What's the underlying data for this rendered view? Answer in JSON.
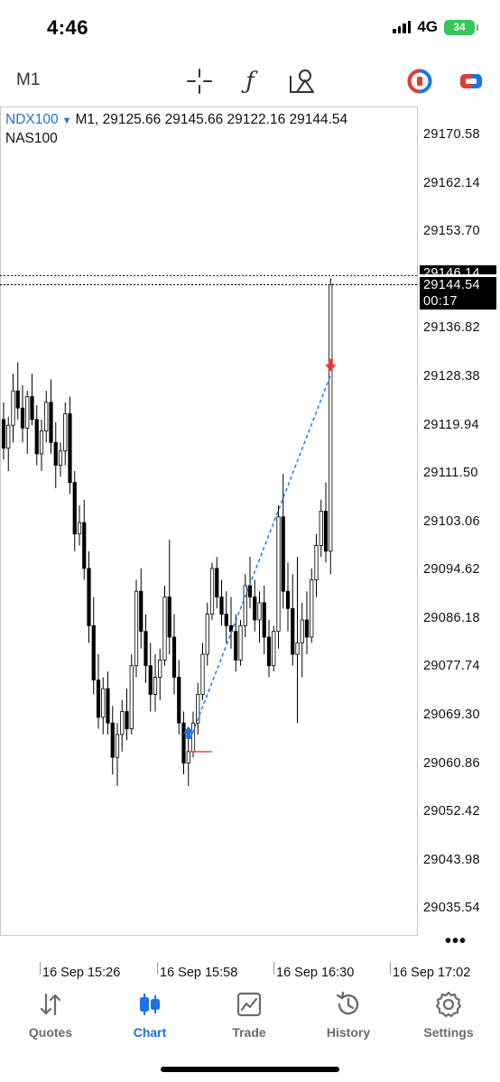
{
  "status": {
    "time": "4:46",
    "network": "4G",
    "battery": "34"
  },
  "toolbar": {
    "timeframe": "M1",
    "icons": [
      "crosshair-icon",
      "indicators-f-icon",
      "objects-icon",
      "one-click-trading-icon",
      "trade-panel-icon"
    ],
    "f_glyph": "ƒ",
    "accent": "#1a73e8",
    "red": "#e53935"
  },
  "chart": {
    "symbol": "NDX100",
    "ohlc_line": "M1, 29125.66 29145.66 29122.16 29144.54",
    "description": "NAS100",
    "price_labels": [
      "29170.58",
      "29162.14",
      "29153.70",
      "29136.82",
      "29128.38",
      "29119.94",
      "29111.50",
      "29103.06",
      "29094.62",
      "29086.18",
      "29077.74",
      "29069.30",
      "29060.86",
      "29052.42",
      "29043.98",
      "29035.54"
    ],
    "ask_label": "29146.14",
    "bid_label": "29144.54",
    "countdown": "00:17",
    "time_labels": [
      "16 Sep 15:26",
      "16 Sep 15:58",
      "16 Sep 16:30",
      "16 Sep 17:02"
    ],
    "more": "•••"
  },
  "chart_data": {
    "type": "candlestick",
    "symbol": "NDX100",
    "timeframe": "M1",
    "y_range": [
      29031.0,
      29175.5
    ],
    "candles": [
      [
        29121.0,
        29124.0,
        29114.0,
        29116.0
      ],
      [
        29116.0,
        29121.5,
        29112.0,
        29120.0
      ],
      [
        29120.0,
        29129.0,
        29117.0,
        29126.0
      ],
      [
        29126.0,
        29131.0,
        29121.0,
        29123.0
      ],
      [
        29123.0,
        29127.0,
        29117.0,
        29119.5
      ],
      [
        29119.5,
        29126.0,
        29115.0,
        29125.0
      ],
      [
        29125.0,
        29129.0,
        29120.0,
        29121.0
      ],
      [
        29121.0,
        29123.5,
        29113.0,
        29115.0
      ],
      [
        29115.0,
        29121.0,
        29112.0,
        29119.0
      ],
      [
        29119.0,
        29126.0,
        29117.0,
        29124.0
      ],
      [
        29124.0,
        29128.0,
        29115.0,
        29117.0
      ],
      [
        29117.0,
        29120.5,
        29109.0,
        29113.0
      ],
      [
        29113.0,
        29117.0,
        29111.0,
        29115.5
      ],
      [
        29115.5,
        29124.0,
        29113.0,
        29122.0
      ],
      [
        29122.0,
        29125.0,
        29108.0,
        29110.0
      ],
      [
        29110.0,
        29112.0,
        29098.0,
        29101.0
      ],
      [
        29101.0,
        29106.0,
        29099.0,
        29103.0
      ],
      [
        29103.0,
        29107.0,
        29093.0,
        29095.0
      ],
      [
        29095.0,
        29098.0,
        29082.0,
        29085.0
      ],
      [
        29085.0,
        29090.0,
        29073.0,
        29075.5
      ],
      [
        29075.5,
        29080.0,
        29067.0,
        29069.0
      ],
      [
        29069.0,
        29076.0,
        29066.0,
        29074.0
      ],
      [
        29074.0,
        29077.0,
        29066.0,
        29068.0
      ],
      [
        29068.0,
        29071.0,
        29059.0,
        29062.0
      ],
      [
        29062.0,
        29068.0,
        29057.0,
        29066.0
      ],
      [
        29066.0,
        29072.0,
        29063.0,
        29070.0
      ],
      [
        29070.0,
        29074.0,
        29065.0,
        29067.0
      ],
      [
        29067.0,
        29080.0,
        29066.0,
        29078.0
      ],
      [
        29078.0,
        29093.0,
        29076.0,
        29091.0
      ],
      [
        29091.0,
        29095.0,
        29081.0,
        29084.0
      ],
      [
        29084.0,
        29087.0,
        29075.0,
        29078.0
      ],
      [
        29078.0,
        29082.0,
        29070.0,
        29073.0
      ],
      [
        29073.0,
        29080.0,
        29070.0,
        29076.0
      ],
      [
        29076.0,
        29081.0,
        29072.0,
        29079.0
      ],
      [
        29079.0,
        29092.0,
        29078.0,
        29090.0
      ],
      [
        29090.0,
        29100.0,
        29080.0,
        29083.0
      ],
      [
        29083.0,
        29087.0,
        29073.0,
        29076.0
      ],
      [
        29076.0,
        29079.0,
        29066.0,
        29068.0
      ],
      [
        29068.0,
        29070.0,
        29059.0,
        29061.0
      ],
      [
        29061.0,
        29065.5,
        29057.0,
        29063.0
      ],
      [
        29063.0,
        29070.0,
        29062.0,
        29068.0
      ],
      [
        29068.0,
        29075.0,
        29066.0,
        29073.0
      ],
      [
        29073.0,
        29082.0,
        29072.0,
        29080.0
      ],
      [
        29080.0,
        29089.0,
        29078.0,
        29087.0
      ],
      [
        29087.0,
        29096.0,
        29086.0,
        29095.0
      ],
      [
        29095.0,
        29097.0,
        29088.0,
        29090.0
      ],
      [
        29090.0,
        29093.0,
        29085.0,
        29087.0
      ],
      [
        29087.0,
        29091.0,
        29082.0,
        29085.0
      ],
      [
        29085.0,
        29090.0,
        29081.0,
        29084.0
      ],
      [
        29084.0,
        29087.0,
        29077.0,
        29079.0
      ],
      [
        29079.0,
        29086.0,
        29078.0,
        29085.0
      ],
      [
        29085.0,
        29094.0,
        29083.0,
        29092.0
      ],
      [
        29092.0,
        29097.0,
        29088.0,
        29090.0
      ],
      [
        29090.0,
        29093.0,
        29084.0,
        29086.0
      ],
      [
        29086.0,
        29091.0,
        29082.0,
        29089.0
      ],
      [
        29089.0,
        29092.0,
        29080.0,
        29083.0
      ],
      [
        29083.0,
        29086.0,
        29076.0,
        29078.0
      ],
      [
        29078.0,
        29085.0,
        29077.0,
        29084.0
      ],
      [
        29084.0,
        29106.0,
        29081.0,
        29104.0
      ],
      [
        29104.0,
        29111.5,
        29088.0,
        29091.0
      ],
      [
        29091.0,
        29096.0,
        29084.0,
        29088.0
      ],
      [
        29088.0,
        29094.0,
        29078.0,
        29080.0
      ],
      [
        29080.0,
        29097.0,
        29068.0,
        29082.0
      ],
      [
        29082.0,
        29089.0,
        29076.0,
        29086.0
      ],
      [
        29086.0,
        29091.0,
        29080.0,
        29083.0
      ],
      [
        29083.0,
        29095.0,
        29082.0,
        29093.0
      ],
      [
        29093.0,
        29101.0,
        29090.0,
        29099.0
      ],
      [
        29099.0,
        29107.0,
        29097.0,
        29105.0
      ],
      [
        29105.0,
        29110.0,
        29096.0,
        29098.0
      ],
      [
        29098.0,
        29145.66,
        29094.0,
        29144.54
      ]
    ],
    "ask": 29146.14,
    "bid": 29144.54,
    "last_ohlc": {
      "open": 29125.66,
      "high": 29145.66,
      "low": 29122.16,
      "close": 29144.54
    },
    "trade": {
      "entry_time_index": 39,
      "entry_price": 29063.0,
      "exit_time_index": 69,
      "exit_price": 29130.0
    },
    "colors": {
      "bull": "#ffffff",
      "bear": "#000000",
      "trade_line": "#1a73e8",
      "buy_arrow": "#1a73e8",
      "sell_arrow": "#e53935"
    }
  },
  "tabs": [
    {
      "label": "Quotes",
      "icon": "quotes-arrows-icon",
      "active": false
    },
    {
      "label": "Chart",
      "icon": "chart-candles-icon",
      "active": true
    },
    {
      "label": "Trade",
      "icon": "trade-chart-icon",
      "active": false
    },
    {
      "label": "History",
      "icon": "history-clock-icon",
      "active": false
    },
    {
      "label": "Settings",
      "icon": "settings-gear-icon",
      "active": false
    }
  ]
}
